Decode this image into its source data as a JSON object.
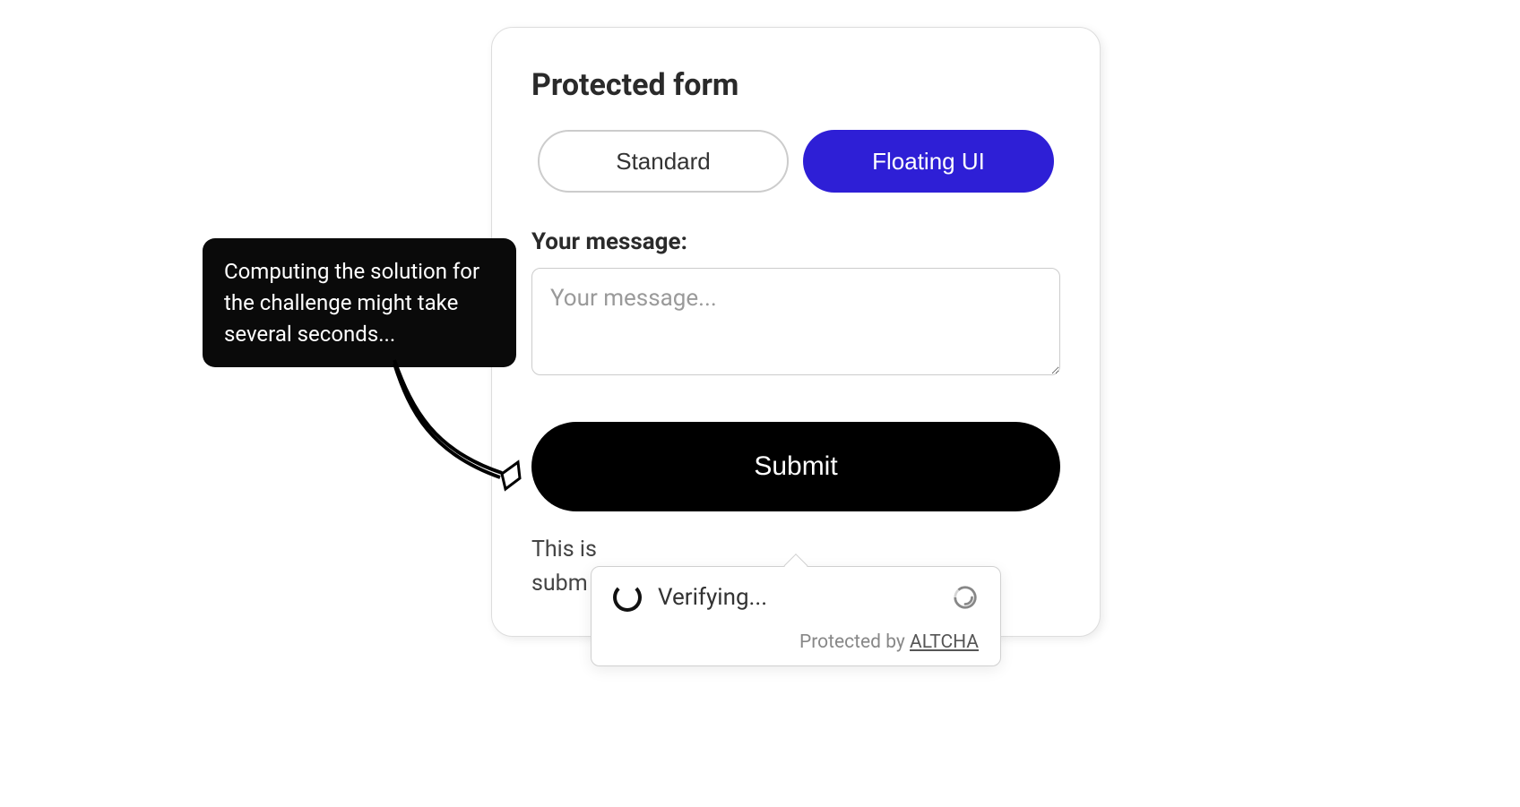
{
  "form": {
    "title": "Protected form",
    "tabs": {
      "standard": "Standard",
      "floating": "Floating UI"
    },
    "message_label": "Your message:",
    "message_placeholder": "Your message...",
    "submit_label": "Submit",
    "helper_prefix": "This is",
    "helper_line2_prefix": "subm"
  },
  "tooltip": {
    "text": "Computing the solution for the challenge might take several seconds..."
  },
  "captcha": {
    "status": "Verifying...",
    "footer_prefix": "Protected by ",
    "footer_link": "ALTCHA"
  }
}
